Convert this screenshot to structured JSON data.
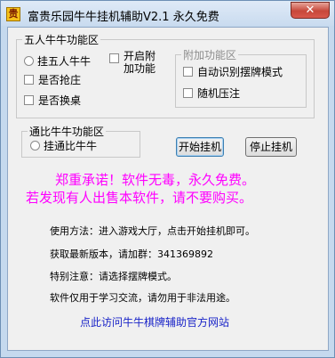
{
  "window": {
    "title": "富贵乐园牛牛挂机辅助V2.1 永久免费",
    "icon_text": "贵",
    "close_glyph": "✕"
  },
  "group_five": {
    "title": "五人牛牛功能区",
    "radio_label": "挂五人牛牛",
    "check_grab": "是否抢庄",
    "check_swap": "是否换桌",
    "check_extra": "开启附\n加功能"
  },
  "group_extra": {
    "title": "附加功能区",
    "check_auto_identify": "自动识别摆牌模式",
    "check_random_bet": "随机压注"
  },
  "group_tongbi": {
    "title": "通比牛牛功能区",
    "radio_label": "挂通比牛牛"
  },
  "buttons": {
    "start": "开始挂机",
    "stop": "停止挂机"
  },
  "promo": {
    "line1": "郑重承诺！软件无毒，永久免费。",
    "line2": "若发现有人出售本软件，请不要购买。"
  },
  "info": {
    "usage": "使用方法：进入游戏大厅，点击开始挂机即可。",
    "version": "获取最新版本，请加群：341369892",
    "notice": "特别注意：请选择摆牌模式。",
    "disclaimer": "软件仅用于学习交流，请勿用于非法用途。"
  },
  "link_text": "点此访问牛牛棋牌辅助官方网站"
}
